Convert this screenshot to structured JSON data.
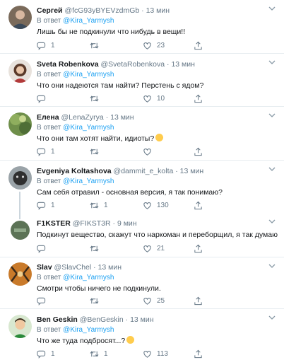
{
  "replying_label": "В ответ",
  "replying_to": "@Kira_Yarmysh",
  "tweets": [
    {
      "name": "Сергей",
      "handle": "@fcG93yBYEVzdmGb",
      "time": "13 мин",
      "text": "Лишь бы не подкинули что нибудь в вещи!!",
      "replies": "1",
      "retweets": "",
      "likes": "23"
    },
    {
      "name": "Sveta Robenkova",
      "handle": "@SvetaRobenkova",
      "time": "13 мин",
      "text": "Что они надеются там найти? Перстень с ядом?",
      "replies": "",
      "retweets": "",
      "likes": "10"
    },
    {
      "name": "Елена",
      "handle": "@LenaZyrya",
      "time": "13 мин",
      "text": "Что они там хотят найти, идиоты?",
      "emoji": "thinking-face-emoji",
      "replies": "1",
      "retweets": "",
      "likes": ""
    },
    {
      "name": "Evgeniya Koltashova",
      "handle": "@dammit_e_kolta",
      "time": "13 мин",
      "text": "Сам себя отравил - основная версия, я так понимаю?",
      "replies": "1",
      "retweets": "1",
      "likes": "130"
    },
    {
      "name": "F1KSTER",
      "handle": "@FIKST3R",
      "time": "9 мин",
      "text": "Подкинут вещество, скажут что наркоман и переборщил, я так думаю...",
      "replies": "",
      "retweets": "",
      "likes": "21"
    },
    {
      "name": "Slav",
      "handle": "@SlavChel",
      "time": "13 мин",
      "text": "Смотри чтобы ничего не подкинули.",
      "replies": "",
      "retweets": "",
      "likes": "25"
    },
    {
      "name": "Ben Geskin",
      "handle": "@BenGeskin",
      "time": "13 мин",
      "text": "Что же туда подбросят...?",
      "emoji": "hushed-face-emoji",
      "replies": "1",
      "retweets": "1",
      "likes": "113"
    }
  ],
  "colors": {
    "accent": "#1da1f2",
    "muted": "#657786",
    "border": "#e6ecf0"
  }
}
